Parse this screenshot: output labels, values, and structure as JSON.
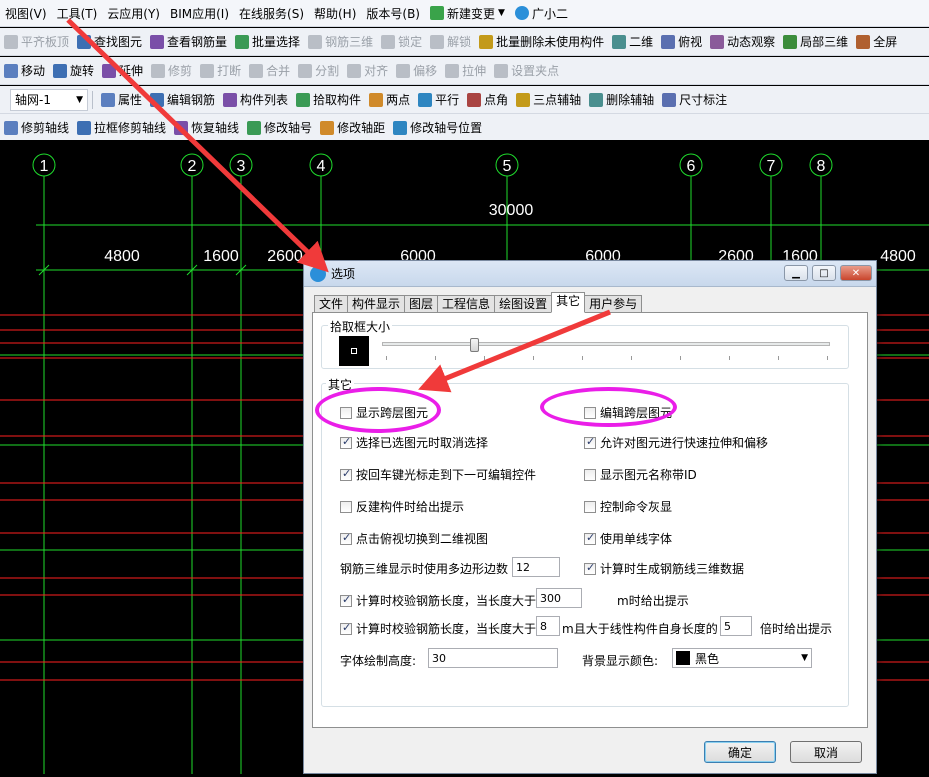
{
  "menu": [
    "视图(V)",
    "工具(T)",
    "云应用(Y)",
    "BIM应用(I)",
    "在线服务(S)",
    "帮助(H)",
    "版本号(B)",
    "新建变更",
    "广小二"
  ],
  "toolbar1": {
    "items": [
      "平齐板顶",
      "查找图元",
      "查看钢筋量",
      "批量选择",
      "钢筋三维",
      "锁定",
      "解锁",
      "批量删除未使用构件",
      "二维",
      "俯视",
      "动态观察",
      "局部三维",
      "全屏"
    ],
    "disabled": [
      0,
      4,
      5,
      6
    ]
  },
  "toolbar2": {
    "items": [
      "移动",
      "旋转",
      "延伸",
      "修剪",
      "打断",
      "合并",
      "分割",
      "对齐",
      "偏移",
      "拉伸",
      "设置夹点"
    ],
    "disabled": [
      3,
      4,
      5,
      6,
      7,
      8,
      9,
      10
    ]
  },
  "toolbar3": {
    "combo": "轴网-1",
    "items": [
      "属性",
      "编辑钢筋",
      "构件列表",
      "拾取构件",
      "两点",
      "平行",
      "点角",
      "三点辅轴",
      "删除辅轴",
      "尺寸标注"
    ]
  },
  "toolbar4": {
    "items": [
      "修剪轴线",
      "拉框修剪轴线",
      "恢复轴线",
      "修改轴号",
      "修改轴距",
      "修改轴号位置"
    ]
  },
  "canvas": {
    "axes": [
      "1",
      "2",
      "3",
      "4",
      "5",
      "6",
      "7",
      "8"
    ],
    "total_dim": "30000",
    "dims": [
      "4800",
      "1600",
      "2600",
      "6000",
      "6000",
      "2600",
      "1600",
      "4800"
    ],
    "line_color": "#1fdc2d",
    "red_line_color": "#ff2020"
  },
  "dialog": {
    "title": "选项",
    "tabs": [
      "文件",
      "构件显示",
      "图层",
      "工程信息",
      "绘图设置",
      "其它",
      "用户参与"
    ],
    "active_tab": 5,
    "pick_group": "拾取框大小",
    "other_group": "其它",
    "checkboxes_left": [
      {
        "label": "显示跨层图元",
        "checked": false
      },
      {
        "label": "选择已选图元时取消选择",
        "checked": true
      },
      {
        "label": "按回车键光标走到下一可编辑控件",
        "checked": true
      },
      {
        "label": "反建构件时给出提示",
        "checked": false
      },
      {
        "label": "点击俯视切换到二维视图",
        "checked": true
      }
    ],
    "checkboxes_right": [
      {
        "label": "编辑跨层图元",
        "checked": false
      },
      {
        "label": "允许对图元进行快速拉伸和偏移",
        "checked": true
      },
      {
        "label": "显示图元名称带ID",
        "checked": false
      },
      {
        "label": "控制命令灰显",
        "checked": false
      },
      {
        "label": "使用单线字体",
        "checked": true
      },
      {
        "label": "计算时生成钢筋线三维数据",
        "checked": true
      }
    ],
    "polygon_label": "钢筋三维显示时使用多边形边数",
    "polygon_value": "12",
    "check_len1_label": "计算时校验钢筋长度，当长度大于",
    "check_len1_checked": true,
    "check_len1_value": "300",
    "check_len1_suffix": "m时给出提示",
    "check_len2_label": "计算时校验钢筋长度，当长度大于",
    "check_len2_checked": true,
    "check_len2_value": "8",
    "check_len2_mid": "m且大于线性构件自身长度的",
    "check_len2_value2": "5",
    "check_len2_suffix": "倍时给出提示",
    "font_height_label": "字体绘制高度:",
    "font_height_value": "30",
    "bg_color_label": "背景显示颜色:",
    "bg_color_value": "黑色",
    "ok": "确定",
    "cancel": "取消"
  },
  "colors": {
    "highlight_ring": "#ea1ee8",
    "arrow": "#f03a3a"
  }
}
